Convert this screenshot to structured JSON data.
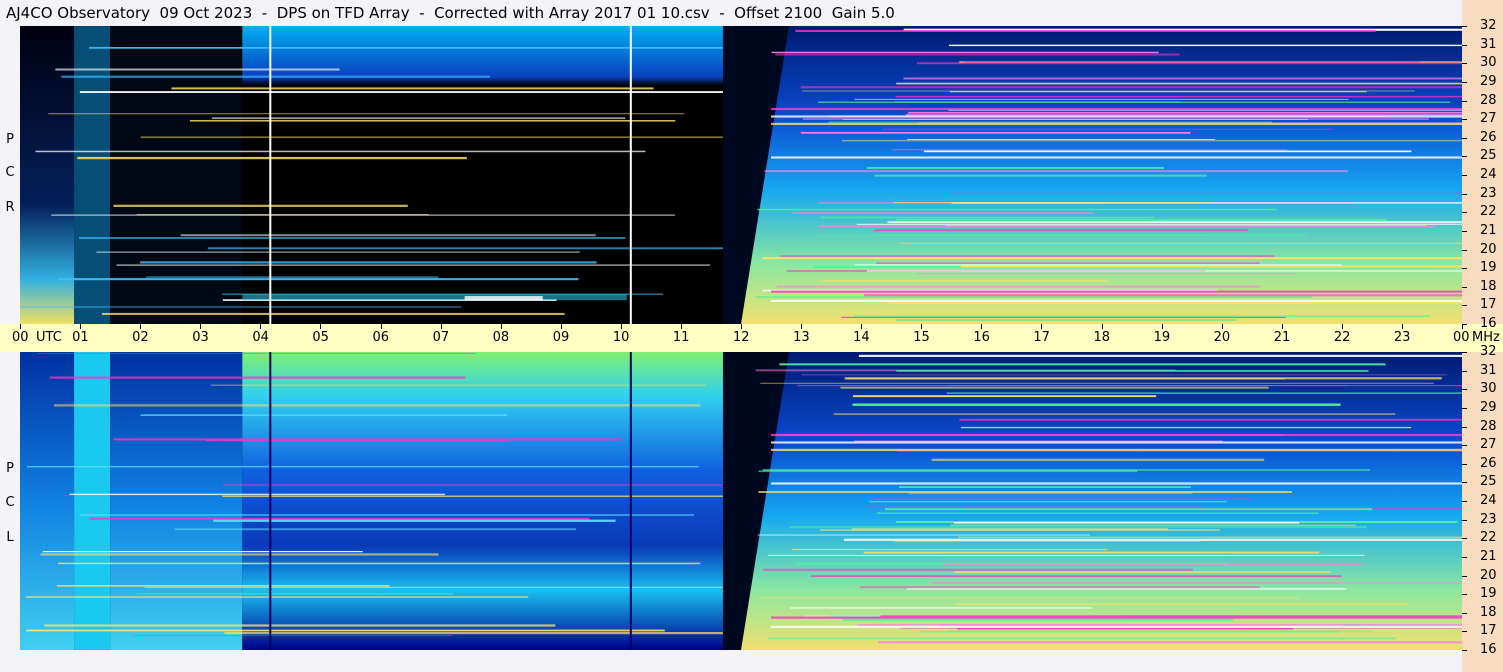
{
  "header": {
    "title": "AJ4CO Observatory  09 Oct 2023  -  DPS on TFD Array  -  Corrected with Array 2017 01 10.csv  -  Offset 2100  Gain 5.0"
  },
  "panels": [
    {
      "id": "rcp",
      "polarization_letters": [
        "R",
        "C",
        "P"
      ]
    },
    {
      "id": "lcp",
      "polarization_letters": [
        "L",
        "C",
        "P"
      ]
    }
  ],
  "chart_data": {
    "type": "heatmap",
    "title": "AJ4CO Observatory  09 Oct 2023  -  DPS on TFD Array  -  Corrected with Array 2017 01 10.csv  -  Offset 2100  Gain 5.0",
    "x_axis": {
      "label": "UTC",
      "range_hours": [
        0,
        24
      ],
      "tick_labels": [
        "00",
        "01",
        "02",
        "03",
        "04",
        "05",
        "06",
        "07",
        "08",
        "09",
        "10",
        "11",
        "12",
        "13",
        "14",
        "15",
        "16",
        "17",
        "18",
        "19",
        "20",
        "21",
        "22",
        "23",
        "00"
      ]
    },
    "y_axis": {
      "label": "MHz",
      "range_mhz": [
        16,
        32
      ],
      "tick_labels": [
        "32",
        "31",
        "30",
        "29",
        "28",
        "27",
        "26",
        "25",
        "24",
        "23",
        "22",
        "21",
        "20",
        "19",
        "18",
        "17",
        "16"
      ]
    },
    "colors": {
      "background": "#000000",
      "low": "#00186e",
      "mid": "#00c8ff",
      "high": "#ffe066",
      "saturation": "#ff30c8",
      "time_band": "#ffffc4",
      "frequency_band": "#f8dcc0"
    },
    "panels": [
      {
        "name": "RCP",
        "regions": [
          {
            "start_utc": 0.0,
            "end_utc": 0.9,
            "intensity": "mixed cyan/yellow"
          },
          {
            "start_utc": 0.9,
            "end_utc": 1.5,
            "intensity": "cyan band"
          },
          {
            "start_utc": 1.5,
            "end_utc": 3.7,
            "intensity": "dark/black"
          },
          {
            "start_utc": 3.7,
            "end_utc": 11.7,
            "intensity": "blue top, black below"
          },
          {
            "start_utc": 11.7,
            "end_utc": 12.8,
            "intensity": "dark with onset"
          },
          {
            "start_utc": 12.8,
            "end_utc": 24.0,
            "intensity": "blue top, cyan/yellow lower"
          }
        ],
        "vertical_lines_utc": [
          4.15,
          10.15
        ]
      },
      {
        "name": "LCP",
        "regions": [
          {
            "start_utc": 0.0,
            "end_utc": 0.9,
            "intensity": "blue/cyan"
          },
          {
            "start_utc": 0.9,
            "end_utc": 1.5,
            "intensity": "cyan band"
          },
          {
            "start_utc": 1.5,
            "end_utc": 3.7,
            "intensity": "blue gradient"
          },
          {
            "start_utc": 3.7,
            "end_utc": 11.7,
            "intensity": "green top, blue/cyan lower"
          },
          {
            "start_utc": 11.7,
            "end_utc": 12.8,
            "intensity": "dark with onset"
          },
          {
            "start_utc": 12.8,
            "end_utc": 24.0,
            "intensity": "blue top, cyan/yellow lower"
          }
        ],
        "vertical_lines_utc": [
          4.15,
          10.15
        ]
      }
    ]
  }
}
